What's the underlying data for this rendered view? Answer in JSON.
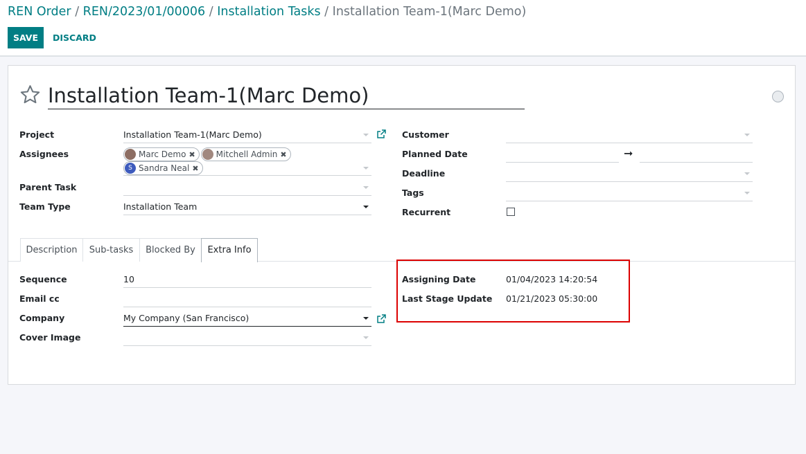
{
  "breadcrumb": {
    "items": [
      "REN Order",
      "REN/2023/01/00006",
      "Installation Tasks"
    ],
    "separator": "/",
    "current": "Installation Team-1(Marc Demo)"
  },
  "toolbar": {
    "save_label": "SAVE",
    "discard_label": "DISCARD"
  },
  "record": {
    "title": "Installation Team-1(Marc Demo)",
    "project_label": "Project",
    "project_value": "Installation Team-1(Marc Demo)",
    "assignees_label": "Assignees",
    "assignees": [
      {
        "name": "Marc Demo",
        "avatar": "photo"
      },
      {
        "name": "Mitchell Admin",
        "avatar": "photo"
      },
      {
        "name": "Sandra Neal",
        "avatar": "S"
      }
    ],
    "parent_task_label": "Parent Task",
    "parent_task_value": "",
    "team_type_label": "Team Type",
    "team_type_value": "Installation Team",
    "customer_label": "Customer",
    "customer_value": "",
    "planned_date_label": "Planned Date",
    "planned_date_arrow": "➞",
    "deadline_label": "Deadline",
    "tags_label": "Tags",
    "recurrent_label": "Recurrent",
    "recurrent_checked": false
  },
  "tabs": [
    {
      "label": "Description",
      "active": false
    },
    {
      "label": "Sub-tasks",
      "active": false
    },
    {
      "label": "Blocked By",
      "active": false
    },
    {
      "label": "Extra Info",
      "active": true
    }
  ],
  "extra_info": {
    "sequence_label": "Sequence",
    "sequence_value": "10",
    "email_cc_label": "Email cc",
    "email_cc_value": "",
    "company_label": "Company",
    "company_value": "My Company (San Francisco)",
    "cover_image_label": "Cover Image",
    "assigning_date_label": "Assigning Date",
    "assigning_date_value": "01/04/2023 14:20:54",
    "last_stage_update_label": "Last Stage Update",
    "last_stage_update_value": "01/21/2023 05:30:00"
  },
  "colors": {
    "accent": "#017e84",
    "highlight": "#dc0000",
    "sandra_avatar": "#3d5bbd"
  }
}
